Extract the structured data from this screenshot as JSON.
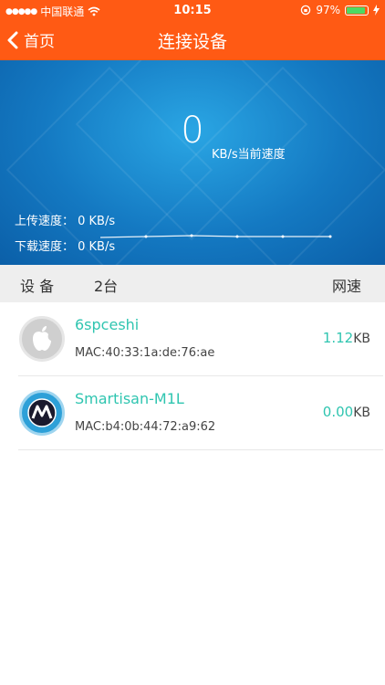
{
  "status": {
    "carrier": "中国联通",
    "time": "10:15",
    "battery": "97%",
    "battery_level": 0.97
  },
  "nav": {
    "back_label": "首页",
    "title": "连接设备"
  },
  "speed": {
    "value": "0",
    "unit_label": "KB/s当前速度",
    "upload": "上传速度： 0 KB/s",
    "download": "下载速度： 0 KB/s"
  },
  "list_header": {
    "devices_label": "设  备",
    "count": "2台",
    "speed_label": "网速"
  },
  "devices": [
    {
      "name": "6spceshi",
      "mac": "MAC:40:33:1a:de:76:ae",
      "speed": "1.12",
      "unit": "KB",
      "icon": "apple-icon"
    },
    {
      "name": "Smartisan-M1L",
      "mac": "MAC:b4:0b:44:72:a9:62",
      "speed": "0.00",
      "unit": "KB",
      "icon": "motorola-icon"
    }
  ],
  "colors": {
    "header_orange": "#ff5a14",
    "accent_teal": "#2fc5b0",
    "panel_blue": "#1479c2"
  }
}
